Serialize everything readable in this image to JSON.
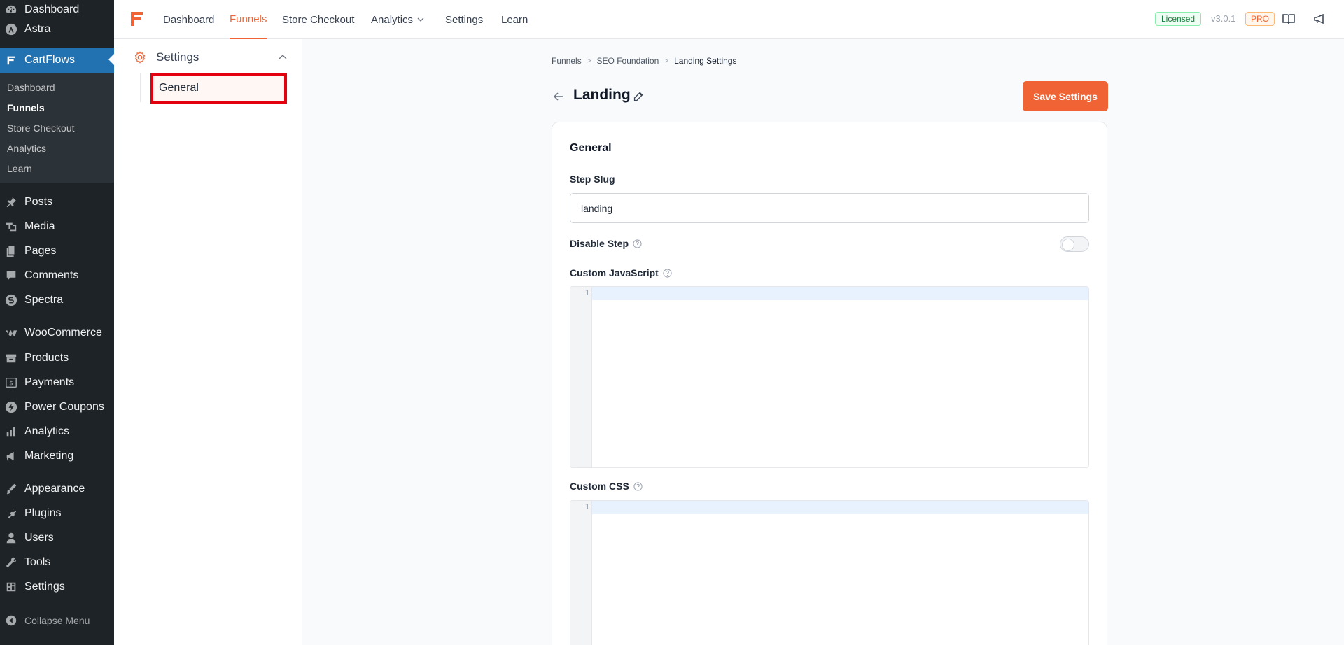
{
  "wp_menu": {
    "top": [
      {
        "label": "Dashboard",
        "icon": "dashboard-icon"
      },
      {
        "label": "Astra",
        "icon": "astra-icon"
      },
      {
        "label": "CartFlows",
        "icon": "cartflows-icon"
      }
    ],
    "cartflows_sub": [
      "Dashboard",
      "Funnels",
      "Store Checkout",
      "Analytics",
      "Learn"
    ],
    "cartflows_sub_current": "Funnels",
    "items": [
      {
        "label": "Posts",
        "icon": "pin-icon"
      },
      {
        "label": "Media",
        "icon": "media-icon"
      },
      {
        "label": "Pages",
        "icon": "pages-icon"
      },
      {
        "label": "Comments",
        "icon": "comments-icon"
      },
      {
        "label": "Spectra",
        "icon": "spectra-icon"
      },
      {
        "label": "WooCommerce",
        "icon": "woocommerce-icon"
      },
      {
        "label": "Products",
        "icon": "products-icon"
      },
      {
        "label": "Payments",
        "icon": "payments-icon"
      },
      {
        "label": "Power Coupons",
        "icon": "power-coupons-icon"
      },
      {
        "label": "Analytics",
        "icon": "analytics-icon"
      },
      {
        "label": "Marketing",
        "icon": "marketing-icon"
      },
      {
        "label": "Appearance",
        "icon": "appearance-icon"
      },
      {
        "label": "Plugins",
        "icon": "plugins-icon"
      },
      {
        "label": "Users",
        "icon": "users-icon"
      },
      {
        "label": "Tools",
        "icon": "tools-icon"
      },
      {
        "label": "Settings",
        "icon": "settings-icon"
      }
    ],
    "collapse": "Collapse Menu"
  },
  "topnav": {
    "items": [
      "Dashboard",
      "Funnels",
      "Store Checkout",
      "Analytics",
      "Settings",
      "Learn"
    ],
    "active": "Funnels",
    "licensed": "Licensed",
    "version": "v3.0.1",
    "pro": "PRO"
  },
  "settings_panel": {
    "title": "Settings",
    "general": "General"
  },
  "breadcrumb": [
    "Funnels",
    "SEO Foundation",
    "Landing Settings"
  ],
  "page": {
    "title": "Landing",
    "save_label": "Save Settings"
  },
  "form": {
    "section_title": "General",
    "step_slug_label": "Step Slug",
    "step_slug_value": "landing",
    "disable_step_label": "Disable Step",
    "disable_step_on": false,
    "custom_js_label": "Custom JavaScript",
    "custom_css_label": "Custom CSS",
    "line_number": "1"
  },
  "colors": {
    "accent": "#f06335",
    "wp_sidebar": "#1d2327",
    "wp_active": "#2271b1",
    "highlight": "#e3000f"
  }
}
